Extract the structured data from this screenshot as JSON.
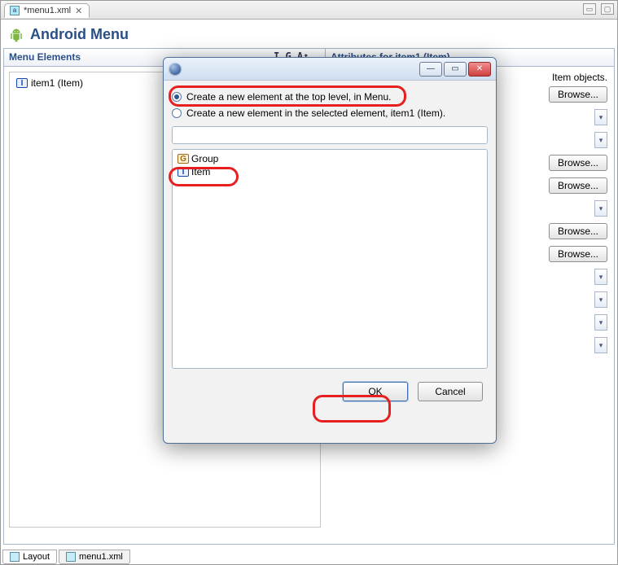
{
  "tab": {
    "label": "*menu1.xml"
  },
  "page_title": "Android Menu",
  "columns": {
    "left": "Menu Elements",
    "right": "Attributes for item1 (Item)"
  },
  "tree": {
    "items": [
      {
        "badge": "I",
        "label": "item1 (Item)"
      }
    ]
  },
  "info_line": "Item objects.",
  "toolbar_icons": "I  G  A↕",
  "browse_label": "Browse...",
  "bottom_tabs": {
    "layout": "Layout",
    "file": "menu1.xml"
  },
  "dialog": {
    "radio1": "Create a new element at the top level, in Menu.",
    "radio2": "Create a new element in the selected element, item1 (Item).",
    "list": [
      {
        "badge": "G",
        "label": "Group"
      },
      {
        "badge": "I",
        "label": "Item"
      }
    ],
    "ok": "OK",
    "cancel": "Cancel"
  }
}
